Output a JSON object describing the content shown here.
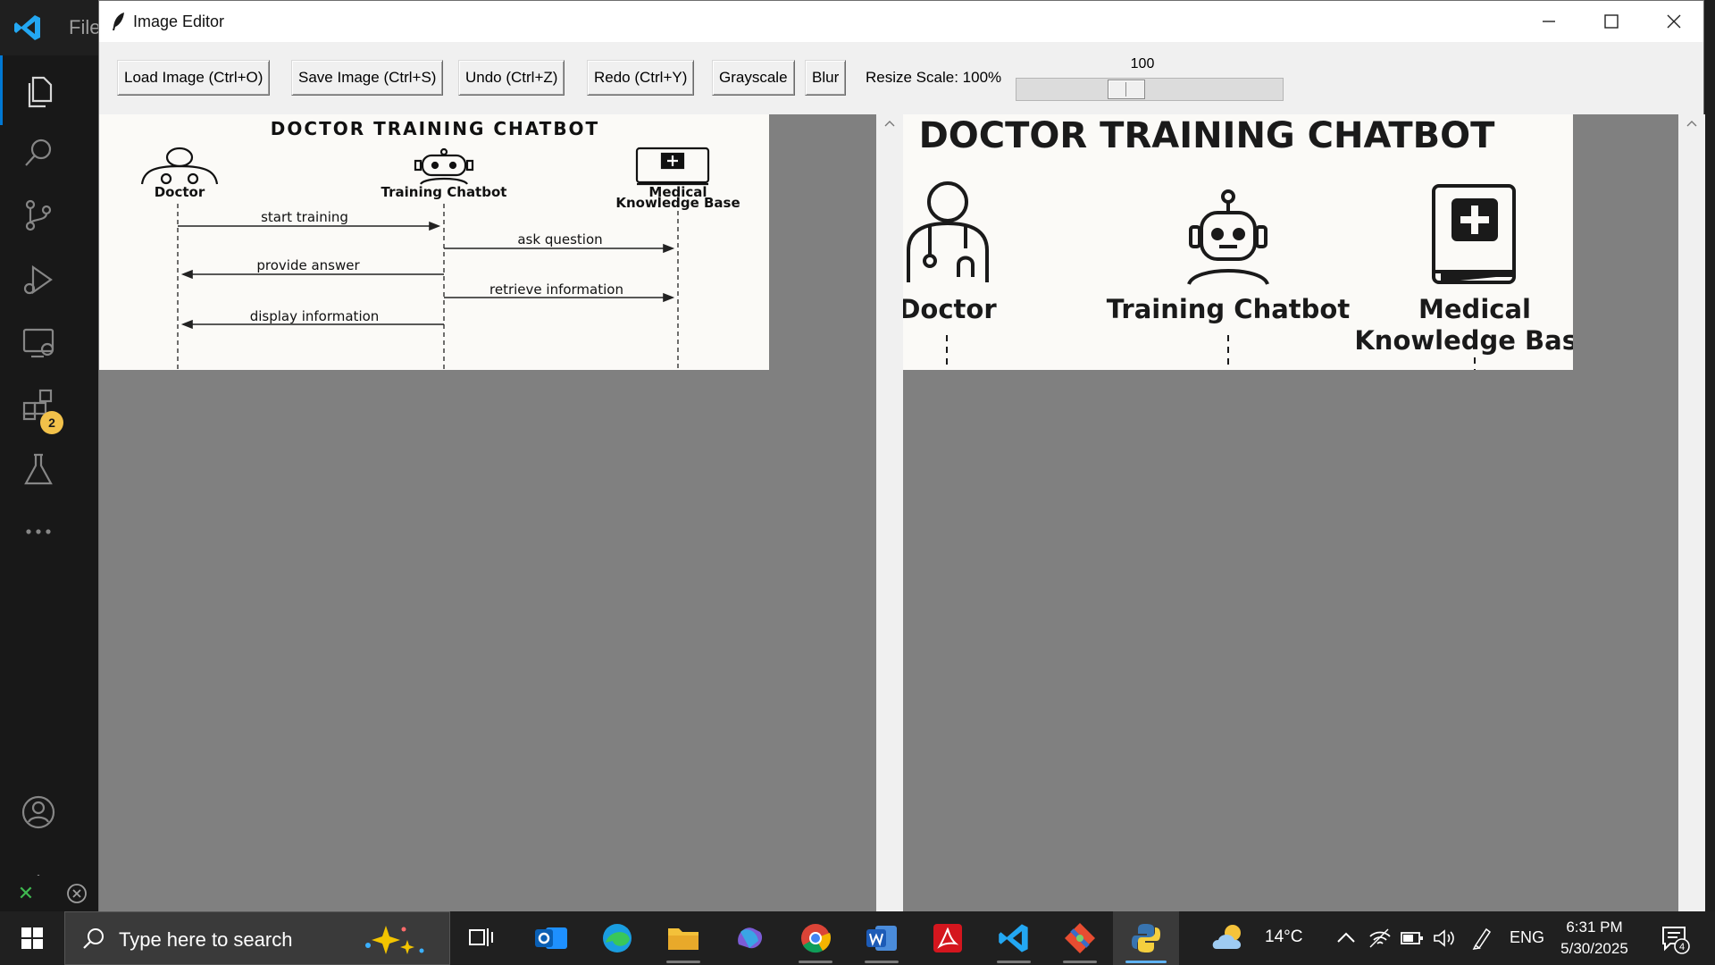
{
  "vscode": {
    "menu_partial": "File",
    "extensions_badge": "2"
  },
  "window": {
    "title": "Image Editor"
  },
  "toolbar": {
    "buttons": [
      "Load Image (Ctrl+O)",
      "Save Image (Ctrl+S)",
      "Undo (Ctrl+Z)",
      "Redo (Ctrl+Y)",
      "Grayscale",
      "Blur"
    ],
    "resize_label": "Resize Scale: 100%",
    "slider_value": "100",
    "slider_fraction": 0.4
  },
  "diagram": {
    "title": "DOCTOR TRAINING CHATBOT",
    "actors": [
      "Doctor",
      "Training Chatbot",
      "Medical",
      "Knowledge Base"
    ],
    "messages": [
      "start training",
      "ask question",
      "provide answer",
      "retrieve information",
      "display information"
    ]
  },
  "taskbar": {
    "search_placeholder": "Type here to search",
    "weather": "14°C",
    "language": "ENG",
    "time": "6:31 PM",
    "date": "5/30/2025",
    "notification_count": "4",
    "apps": [
      "outlook",
      "edge",
      "file-explorer",
      "microsoft-365",
      "chrome",
      "word",
      "acrobat",
      "vscode",
      "git",
      "python"
    ]
  }
}
